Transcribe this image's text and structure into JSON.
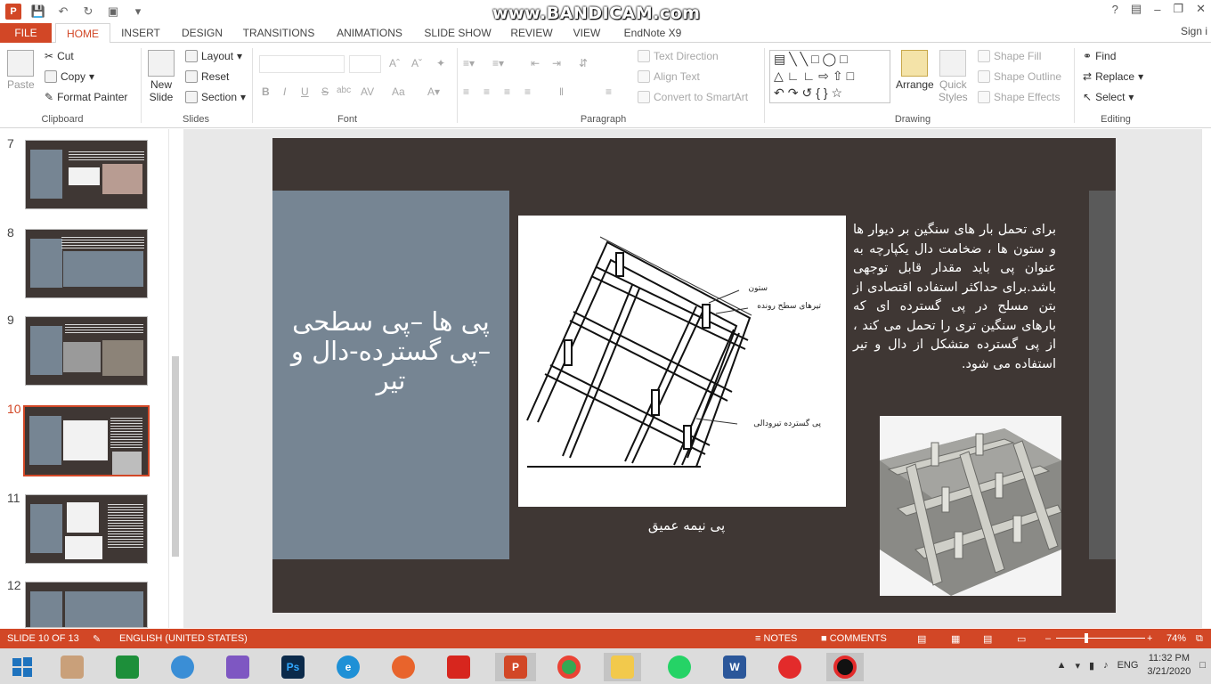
{
  "watermark": "www.BANDICAM.com",
  "tabs": {
    "file": "FILE",
    "home": "HOME",
    "insert": "INSERT",
    "design": "DESIGN",
    "transitions": "TRANSITIONS",
    "animations": "ANIMATIONS",
    "slideshow": "SLIDE SHOW",
    "review": "REVIEW",
    "view": "VIEW",
    "endnote": "EndNote X9",
    "signin": "Sign i"
  },
  "ribbon": {
    "clipboard": {
      "paste": "Paste",
      "cut": "Cut",
      "copy": "Copy",
      "format_painter": "Format Painter",
      "label": "Clipboard"
    },
    "slides": {
      "new_slide": "New",
      "new_slide2": "Slide",
      "layout": "Layout",
      "reset": "Reset",
      "section": "Section",
      "label": "Slides"
    },
    "font": {
      "label": "Font",
      "bold": "B",
      "italic": "I",
      "underline": "U",
      "strike": "S",
      "shadow": "abc"
    },
    "paragraph": {
      "label": "Paragraph",
      "text_direction": "Text Direction",
      "align_text": "Align Text",
      "convert": "Convert to SmartArt"
    },
    "drawing": {
      "label": "Drawing",
      "arrange": "Arrange",
      "quick": "Quick",
      "styles": "Styles",
      "shape_fill": "Shape Fill",
      "shape_outline": "Shape Outline",
      "shape_effects": "Shape Effects"
    },
    "editing": {
      "label": "Editing",
      "find": "Find",
      "replace": "Replace",
      "select": "Select"
    }
  },
  "thumbnails": [
    "7",
    "8",
    "9",
    "10",
    "11",
    "12"
  ],
  "slide": {
    "title": "پی ها –پی سطحی –پی گسترده-دال و تیر",
    "body": "برای تحمل بار های سنگین بر دیوار ها و ستون ها ، ضخامت دال یکپارچه به عنوان پی باید مقدار قابل توجهی باشد.برای حداکثر استفاده اقتصادی از بتن مسلح در پی گسترده ای که بارهای سنگین تری را تحمل می کند ، از پی گسترده متشکل از دال و تیر استفاده می شود.",
    "caption": "پی نیمه عمیق",
    "drawing_labels": [
      "ستون",
      "تیرهای سطح رونده",
      "پی گسترده تیرودالی"
    ]
  },
  "status": {
    "slide": "SLIDE 10 OF 13",
    "language": "ENGLISH (UNITED STATES)",
    "notes": "NOTES",
    "comments": "COMMENTS",
    "zoom": "74%"
  },
  "taskbar": {
    "lang": "ENG",
    "time": "11:32 PM",
    "date": "3/21/2020"
  }
}
